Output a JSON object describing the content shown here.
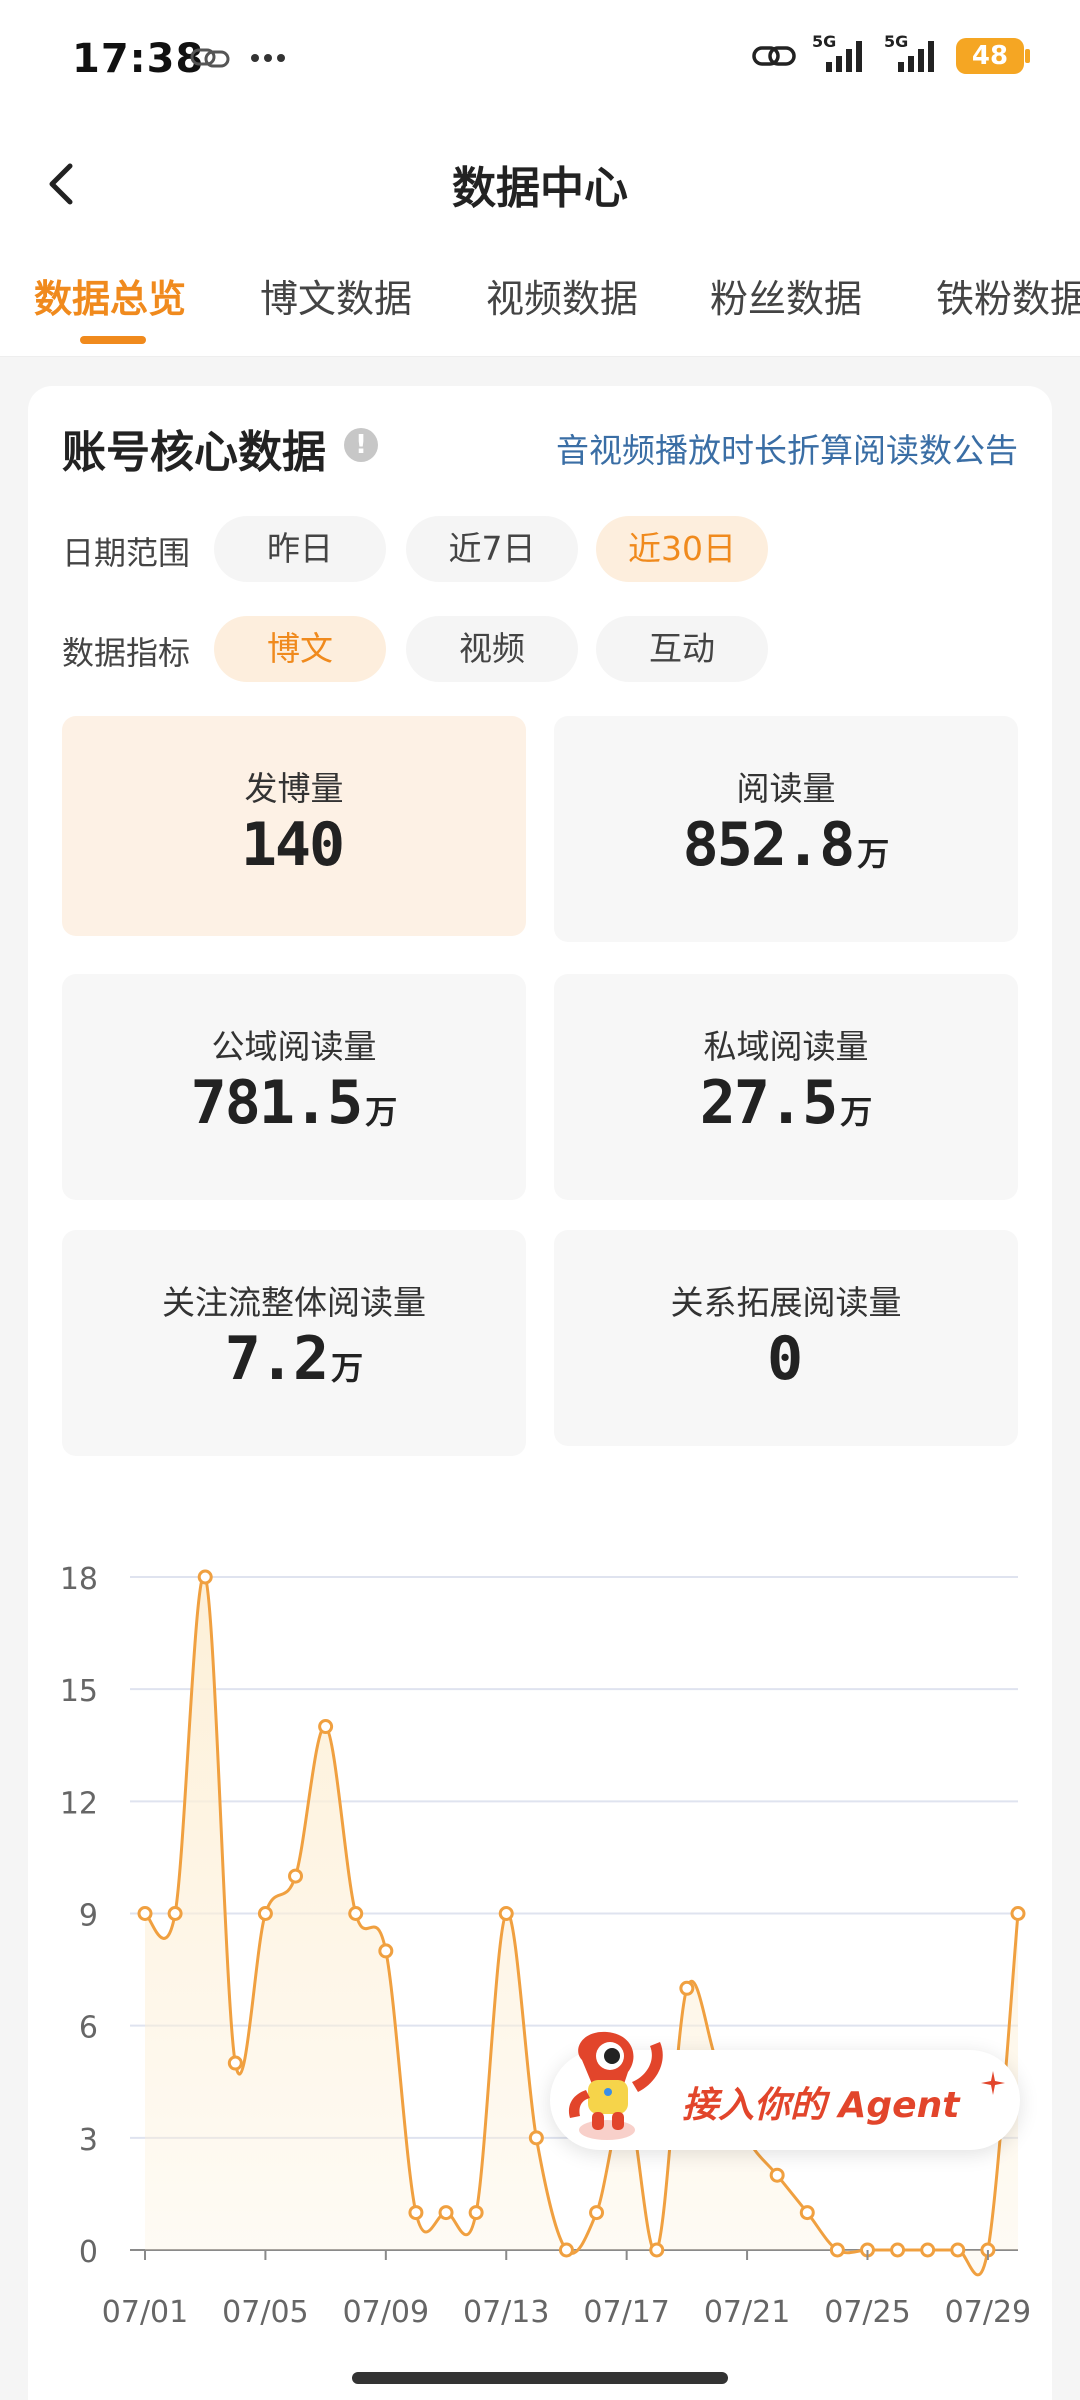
{
  "status_bar": {
    "time": "17:38",
    "signal1": "5G",
    "signal2": "5G",
    "battery": "48"
  },
  "nav": {
    "title": "数据中心"
  },
  "tabs": [
    {
      "label": "数据总览",
      "active": true
    },
    {
      "label": "博文数据",
      "active": false
    },
    {
      "label": "视频数据",
      "active": false
    },
    {
      "label": "粉丝数据",
      "active": false
    },
    {
      "label": "铁粉数据",
      "active": false
    }
  ],
  "card": {
    "title": "账号核心数据",
    "info_icon": "!",
    "notice_link": "音视频播放时长折算阅读数公告"
  },
  "filters": {
    "date_label": "日期范围",
    "date_options": [
      "昨日",
      "近7日",
      "近30日"
    ],
    "date_selected": "近30日",
    "metric_label": "数据指标",
    "metric_options": [
      "博文",
      "视频",
      "互动"
    ],
    "metric_selected": "博文"
  },
  "metrics": [
    {
      "label": "发博量",
      "value": "140",
      "unit": ""
    },
    {
      "label": "阅读量",
      "value": "852.8",
      "unit": "万"
    },
    {
      "label": "公域阅读量",
      "value": "781.5",
      "unit": "万"
    },
    {
      "label": "私域阅读量",
      "value": "27.5",
      "unit": "万"
    },
    {
      "label": "关注流整体阅读量",
      "value": "7.2",
      "unit": "万"
    },
    {
      "label": "关系拓展阅读量",
      "value": "0",
      "unit": ""
    }
  ],
  "agent": {
    "label": "接入你的 Agent"
  },
  "colors": {
    "accent": "#f08a1d",
    "line": "#f0a040",
    "fill": "#fdf0d8",
    "link": "#3a6ea5"
  },
  "chart_data": {
    "type": "area",
    "x": [
      "07/01",
      "07/02",
      "07/03",
      "07/04",
      "07/05",
      "07/06",
      "07/07",
      "07/08",
      "07/09",
      "07/10",
      "07/11",
      "07/12",
      "07/13",
      "07/14",
      "07/15",
      "07/16",
      "07/17",
      "07/18",
      "07/19",
      "07/20",
      "07/21",
      "07/22",
      "07/23",
      "07/24",
      "07/25",
      "07/26",
      "07/27",
      "07/28",
      "07/29",
      "07/30"
    ],
    "x_tick_labels": [
      "07/01",
      "07/05",
      "07/09",
      "07/13",
      "07/17",
      "07/21",
      "07/25",
      "07/29"
    ],
    "series": [
      {
        "values": [
          9,
          9,
          18,
          5,
          9,
          10,
          14,
          9,
          8,
          1,
          1,
          1,
          9,
          3,
          0,
          1,
          4,
          0,
          7,
          5,
          3,
          2,
          1,
          0,
          0,
          0,
          0,
          0,
          0,
          9
        ]
      }
    ],
    "y_ticks": [
      0,
      3,
      6,
      9,
      12,
      15,
      18
    ],
    "ylim": [
      0,
      18
    ],
    "grid": true,
    "legend": "none"
  }
}
